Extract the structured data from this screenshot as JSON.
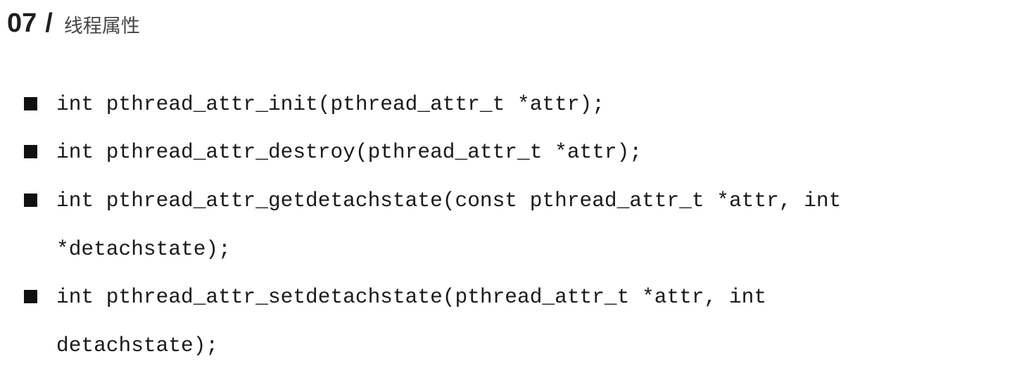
{
  "header": {
    "number": "07",
    "separator": "/",
    "title": "线程属性"
  },
  "items": [
    {
      "lines": [
        "int pthread_attr_init(pthread_attr_t *attr);"
      ]
    },
    {
      "lines": [
        "int pthread_attr_destroy(pthread_attr_t *attr);"
      ]
    },
    {
      "lines": [
        "int pthread_attr_getdetachstate(const pthread_attr_t *attr, int",
        "*detachstate);"
      ]
    },
    {
      "lines": [
        "int pthread_attr_setdetachstate(pthread_attr_t *attr, int",
        "detachstate);"
      ]
    }
  ]
}
